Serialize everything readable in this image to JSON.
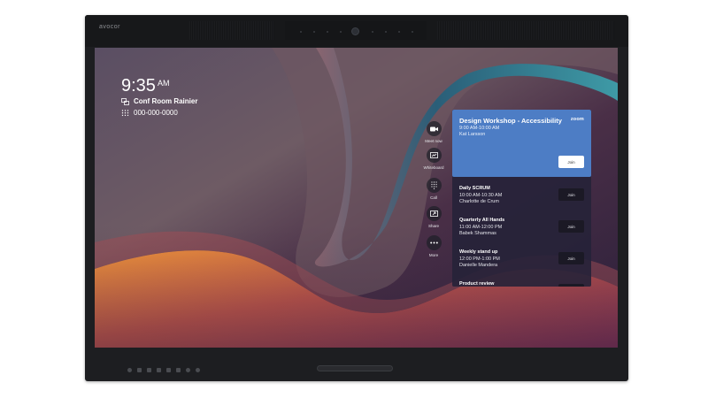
{
  "device": {
    "brand": "avocor"
  },
  "home": {
    "time": "9:35",
    "ampm": "AM",
    "room_name": "Conf Room Rainier",
    "phone_number": "000-000-0000"
  },
  "rail": [
    {
      "label": "Meet now",
      "icon": "video-camera-icon"
    },
    {
      "label": "Whiteboard",
      "icon": "whiteboard-icon"
    },
    {
      "label": "Call",
      "icon": "dialpad-icon"
    },
    {
      "label": "Share",
      "icon": "share-screen-icon"
    },
    {
      "label": "More",
      "icon": "more-dots-icon"
    }
  ],
  "featured_meeting": {
    "title": "Design Workshop - Accessibility",
    "provider": "zoom",
    "time": "9:00 AM-10:00 AM",
    "organizer": "Kat Larsson",
    "join_label": "Join"
  },
  "meetings": [
    {
      "title": "Daily SCRUM",
      "time": "10:00 AM-10:30 AM",
      "organizer": "Charlotte de Crum",
      "join_label": "Join"
    },
    {
      "title": "Quarterly All Hands",
      "time": "11:00 AM-12:00 PM",
      "organizer": "Babek Shammas",
      "join_label": "Join"
    },
    {
      "title": "Weekly stand up",
      "time": "12:00 PM-1:00 PM",
      "organizer": "Danielle Mandera",
      "join_label": "Join"
    },
    {
      "title": "Product review",
      "time": "",
      "organizer": "",
      "join_label": ""
    }
  ],
  "colors": {
    "featured_card": "#4d7dc5",
    "bezel": "#1d1e21",
    "panel_bg": "#262238"
  }
}
